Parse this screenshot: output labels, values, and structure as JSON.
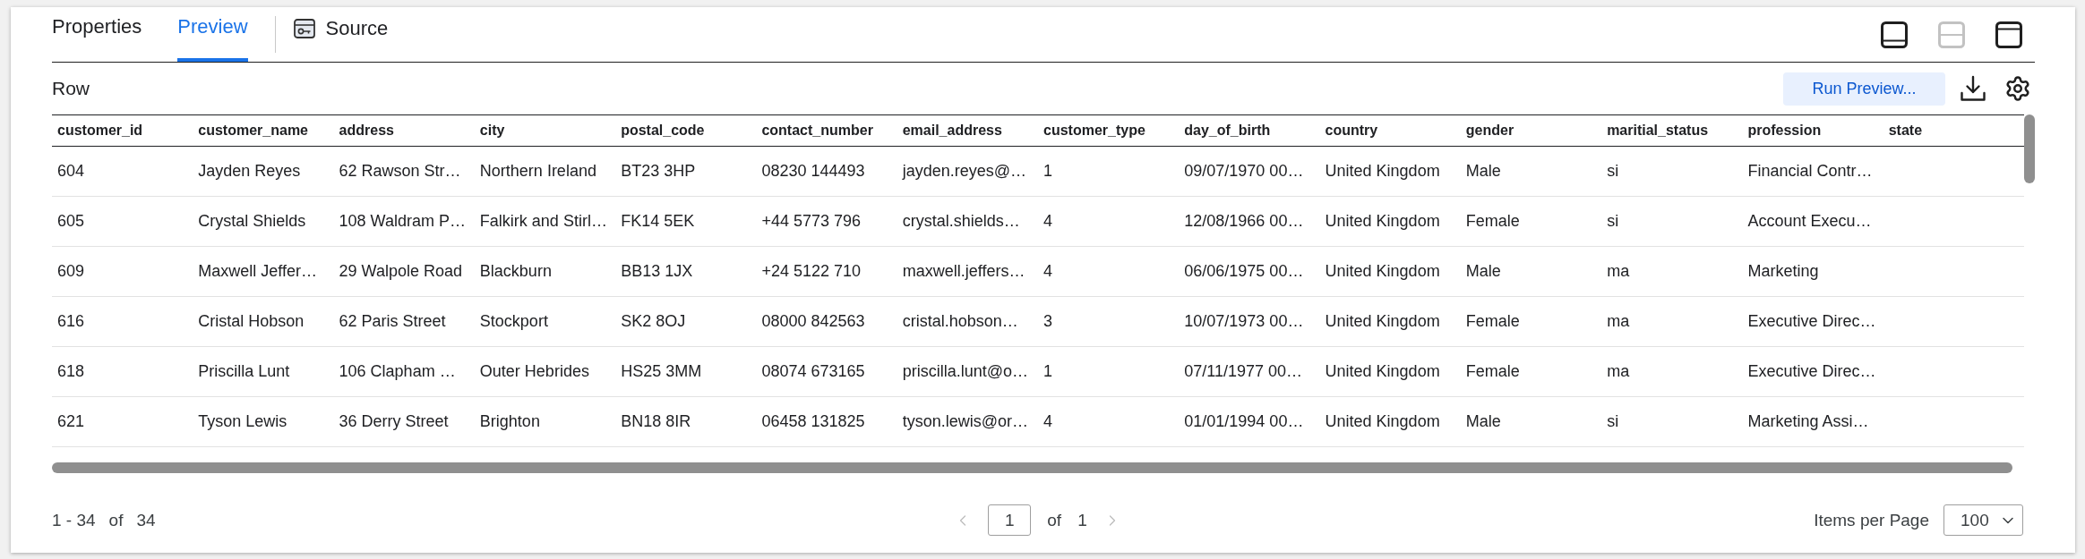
{
  "tabs": [
    {
      "label": "Properties",
      "selected": false
    },
    {
      "label": "Preview",
      "selected": true
    }
  ],
  "source_button": {
    "label": "Source"
  },
  "layout_buttons": [
    {
      "kind": "bottom",
      "disabled": false
    },
    {
      "kind": "split",
      "disabled": true
    },
    {
      "kind": "top",
      "disabled": false
    }
  ],
  "section": {
    "title": "Row",
    "run_button": "Run Preview..."
  },
  "table": {
    "columns": [
      "customer_id",
      "customer_name",
      "address",
      "city",
      "postal_code",
      "contact_number",
      "email_address",
      "customer_type",
      "day_of_birth",
      "country",
      "gender",
      "maritial_status",
      "profession",
      "state"
    ],
    "rows": [
      {
        "cells": [
          "604",
          "Jayden Reyes",
          "62 Rawson Str…",
          "Northern Ireland",
          "BT23 3HP",
          "08230 144493",
          "jayden.reyes@…",
          "1",
          "09/07/1970 00…",
          "United Kingdom",
          "Male",
          "si",
          "Financial Contr…"
        ]
      },
      {
        "cells": [
          "605",
          "Crystal Shields",
          "108 Waldram P…",
          "Falkirk and Stirl…",
          "FK14 5EK",
          "+44 5773 796",
          "crystal.shields…",
          "4",
          "12/08/1966 00…",
          "United Kingdom",
          "Female",
          "si",
          "Account Execu…"
        ]
      },
      {
        "cells": [
          "609",
          "Maxwell Jeffer…",
          "29 Walpole Road",
          "Blackburn",
          "BB13 1JX",
          "+24 5122 710",
          "maxwell.jeffers…",
          "4",
          "06/06/1975 00…",
          "United Kingdom",
          "Male",
          "ma",
          "Marketing"
        ]
      },
      {
        "cells": [
          "616",
          "Cristal Hobson",
          "62 Paris Street",
          "Stockport",
          "SK2 8OJ",
          "08000 842563",
          "cristal.hobson…",
          "3",
          "10/07/1973 00…",
          "United Kingdom",
          "Female",
          "ma",
          "Executive Direc…"
        ]
      },
      {
        "cells": [
          "618",
          "Priscilla Lunt",
          "106 Clapham …",
          "Outer Hebrides",
          "HS25 3MM",
          "08074 673165",
          "priscilla.lunt@o…",
          "1",
          "07/11/1977 00…",
          "United Kingdom",
          "Female",
          "ma",
          "Executive Direc…"
        ]
      },
      {
        "cells": [
          "621",
          "Tyson Lewis",
          "36 Derry Street",
          "Brighton",
          "BN18 8IR",
          "06458 131825",
          "tyson.lewis@or…",
          "4",
          "01/01/1994 00…",
          "United Kingdom",
          "Male",
          "si",
          "Marketing Assi…"
        ]
      }
    ]
  },
  "footer": {
    "range": "1 - 34",
    "of_label": "of",
    "total": "34",
    "pager": {
      "prev": {
        "disabled": true
      },
      "page": "1",
      "of_label": "of",
      "page_count": "1",
      "next": {
        "disabled": true
      }
    },
    "items_per_page_label": "Items per Page",
    "items_per_page": "100"
  }
}
